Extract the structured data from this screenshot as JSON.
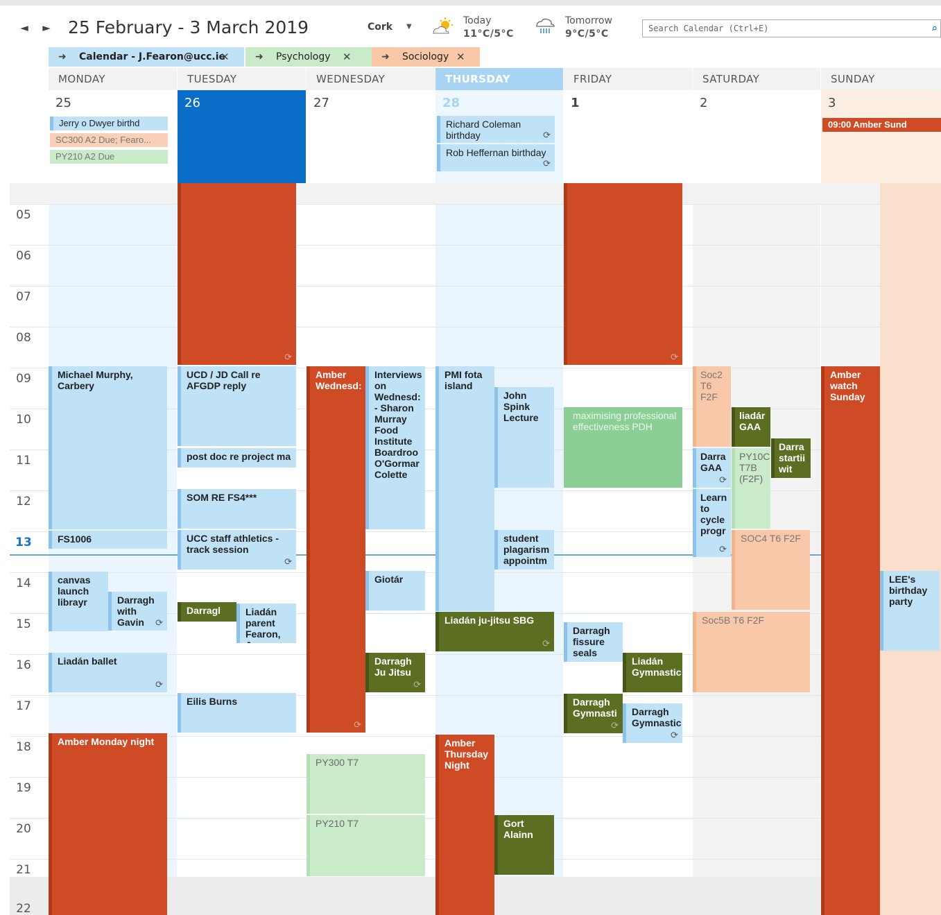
{
  "header": {
    "date_range": "25 February - 3 March 2019",
    "prev_label": "◄",
    "next_label": "►",
    "city": "Cork",
    "today_label": "Today",
    "today_temp": "11°C/5°C",
    "tomorrow_label": "Tomorrow",
    "tomorrow_temp": "9°C/5°C",
    "search_placeholder": "Search Calendar (Ctrl+E)"
  },
  "tabs": [
    {
      "label": "Calendar - J.Fearon@ucc.ie",
      "color": "#bfe2f7"
    },
    {
      "label": "Psychology",
      "color": "#c9ebc9"
    },
    {
      "label": "Sociology",
      "color": "#f8c8a8"
    }
  ],
  "days": [
    {
      "name": "MONDAY",
      "num": "25"
    },
    {
      "name": "TUESDAY",
      "num": "26"
    },
    {
      "name": "WEDNESDAY",
      "num": "27"
    },
    {
      "name": "THURSDAY",
      "num": "28"
    },
    {
      "name": "FRIDAY",
      "num": "1"
    },
    {
      "name": "SATURDAY",
      "num": "2"
    },
    {
      "name": "SUNDAY",
      "num": "3"
    }
  ],
  "hours": [
    "05",
    "06",
    "07",
    "08",
    "09",
    "10",
    "11",
    "12",
    "13",
    "14",
    "15",
    "16",
    "17",
    "18",
    "19",
    "20",
    "21",
    "22"
  ],
  "allday": {
    "mon_1": "Jerry o Dwyer birthd",
    "mon_2": "SC300 A2 Due; Fearo...",
    "mon_3": "PY210 A2 Due",
    "thu_1": "Richard Coleman birthday",
    "thu_2": "Rob Heffernan birthday",
    "sun_1": "09:00 Amber Sund"
  },
  "events": {
    "mon_michael": "Michael Murphy, Carbery",
    "mon_fs1006": "FS1006",
    "mon_canvas": "canvas launch librayr",
    "mon_darragh": "Darragh with Gavin",
    "mon_ballet": "Liadán ballet",
    "mon_amber": "Amber Monday night",
    "tue_ucd": "UCD / JD Call re AFGDP reply",
    "tue_postdoc": "post doc re project ma",
    "tue_som": "SOM RE FS4***",
    "tue_ucc": "UCC staff athletics - track session",
    "tue_darragh": "Darragl",
    "tue_liadan": "Liadán parent Fearon, Jc",
    "tue_eilis": "Eilis Burns",
    "wed_amber": "Amber Wednesd:",
    "wed_interviews": "Interviews on Wednesd: - Sharon Murray Food Institute Boardroo O'Gormar Colette",
    "wed_giotar": "Giotár",
    "wed_darragh": "Darragh Ju Jitsu",
    "wed_py300": "PY300 T7",
    "wed_py210": "PY210 T7",
    "thu_pmi": "PMI fota island",
    "thu_john": "John Spink Lecture",
    "thu_student": "student plagarism appointm",
    "thu_liadan": "Liadán ju-jitsu SBG",
    "thu_amber": "Amber Thursday Night",
    "thu_gort": "Gort Alainn",
    "fri_max": "maximising professional effectiveness PDH",
    "fri_fissure": "Darragh fissure seals",
    "fri_liadan": "Liadán Gymnastic",
    "fri_darragh1": "Darragh Gymnasti",
    "fri_darragh2": "Darragh Gymnastic",
    "sat_soc2": "Soc2 T6 F2F",
    "sat_liadan": "liadár GAA",
    "sat_darra1": "Darra startii wit",
    "sat_darra2": "Darra GAA",
    "sat_py100": "PY10C T7B (F2F)",
    "sat_learn": "Learn to cycle progr",
    "sat_soc4": "SOC4 T6 F2F",
    "sat_soc5": "Soc5B T6 F2F",
    "sun_amber": "Amber watch Sunday",
    "sun_lee": "LEE's birthday party"
  },
  "colors": {
    "blue": "#bfe2f7",
    "red": "#cf4b26",
    "olive": "#5b6e22",
    "green": "#c9ebc9",
    "peach": "#f8c8a8",
    "selected": "#0a6ec8"
  }
}
